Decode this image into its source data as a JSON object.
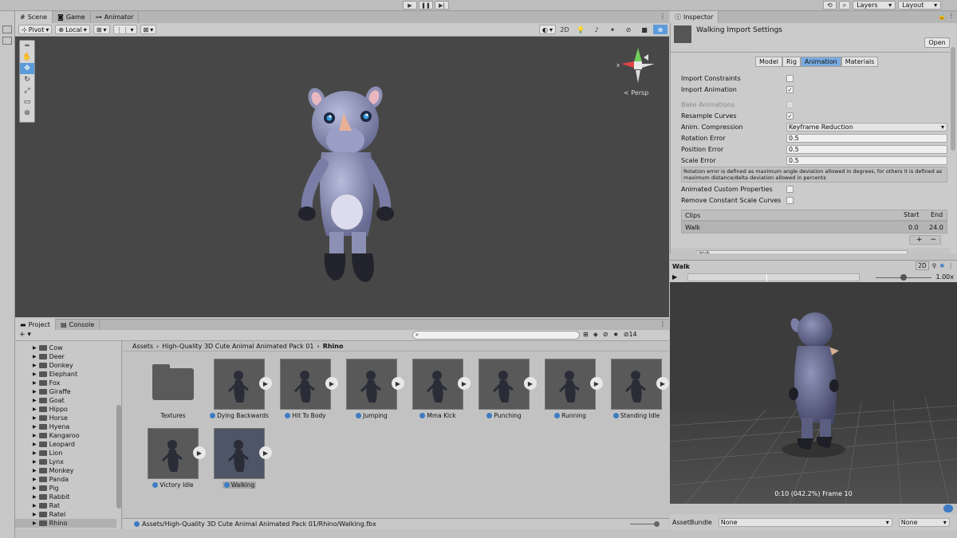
{
  "topbar": {
    "layers_label": "Layers",
    "layout_label": "Layout"
  },
  "scene_tabs": [
    "Scene",
    "Game",
    "Animator"
  ],
  "scene_toolbar": {
    "pivot": "Pivot",
    "local": "Local",
    "mode_2d": "2D"
  },
  "gizmo": {
    "x_label": "x",
    "persp_label": "< Persp"
  },
  "project_tabs": [
    "Project",
    "Console"
  ],
  "project_toolbar": {
    "hidden_count": "14"
  },
  "tree_items": [
    "Cow",
    "Deer",
    "Donkey",
    "Elephant",
    "Fox",
    "Giraffe",
    "Goat",
    "Hippo",
    "Horse",
    "Hyena",
    "Kangaroo",
    "Leopard",
    "Lion",
    "Lynx",
    "Monkey",
    "Panda",
    "Pig",
    "Rabbit",
    "Rat",
    "Ratel",
    "Rhino"
  ],
  "breadcrumb": [
    "Assets",
    "High-Quality 3D Cute Animal Animated Pack 01",
    "Rhino"
  ],
  "assets": [
    {
      "label": "Textures"
    },
    {
      "label": "Dying Backwards"
    },
    {
      "label": "Hit To Body"
    },
    {
      "label": "Jumping"
    },
    {
      "label": "Mma Kick"
    },
    {
      "label": "Punching"
    },
    {
      "label": "Running"
    },
    {
      "label": "Standing Idle"
    },
    {
      "label": "Victory Idle"
    },
    {
      "label": "Walking"
    }
  ],
  "status_path": "Assets/High-Quality 3D Cute Animal Animated Pack 01/Rhino/Walking.fbx",
  "inspector": {
    "tab": "Inspector",
    "title": "Walking Import Settings",
    "open_button": "Open",
    "subtabs": [
      "Model",
      "Rig",
      "Animation",
      "Materials"
    ],
    "import_constraints": "Import Constraints",
    "import_animation": "Import Animation",
    "bake_animations": "Bake Animations",
    "resample_curves": "Resample Curves",
    "anim_compression": "Anim. Compression",
    "anim_compression_value": "Keyframe Reduction",
    "rotation_error": "Rotation Error",
    "rotation_error_value": "0.5",
    "position_error": "Position Error",
    "position_error_value": "0.5",
    "scale_error": "Scale Error",
    "scale_error_value": "0.5",
    "help_text": "Rotation error is defined as maximum angle deviation allowed in degrees, for others it is defined as maximum distance/delta deviation allowed in percents",
    "animated_custom_properties": "Animated Custom Properties",
    "remove_constant_scale_curves": "Remove Constant Scale Curves",
    "clips_header": "Clips",
    "start_header": "Start",
    "end_header": "End",
    "clip_name": "Walk",
    "clip_start": "0.0",
    "clip_end": "24.0",
    "clip_field": "Walk"
  },
  "preview": {
    "title": "Walk",
    "mode_2d": "2D",
    "speed": "1.00x",
    "timecode": "0:10 (042.2%) Frame 10"
  },
  "assetbundle": {
    "label": "AssetBundle",
    "value": "None",
    "variant": "None"
  }
}
